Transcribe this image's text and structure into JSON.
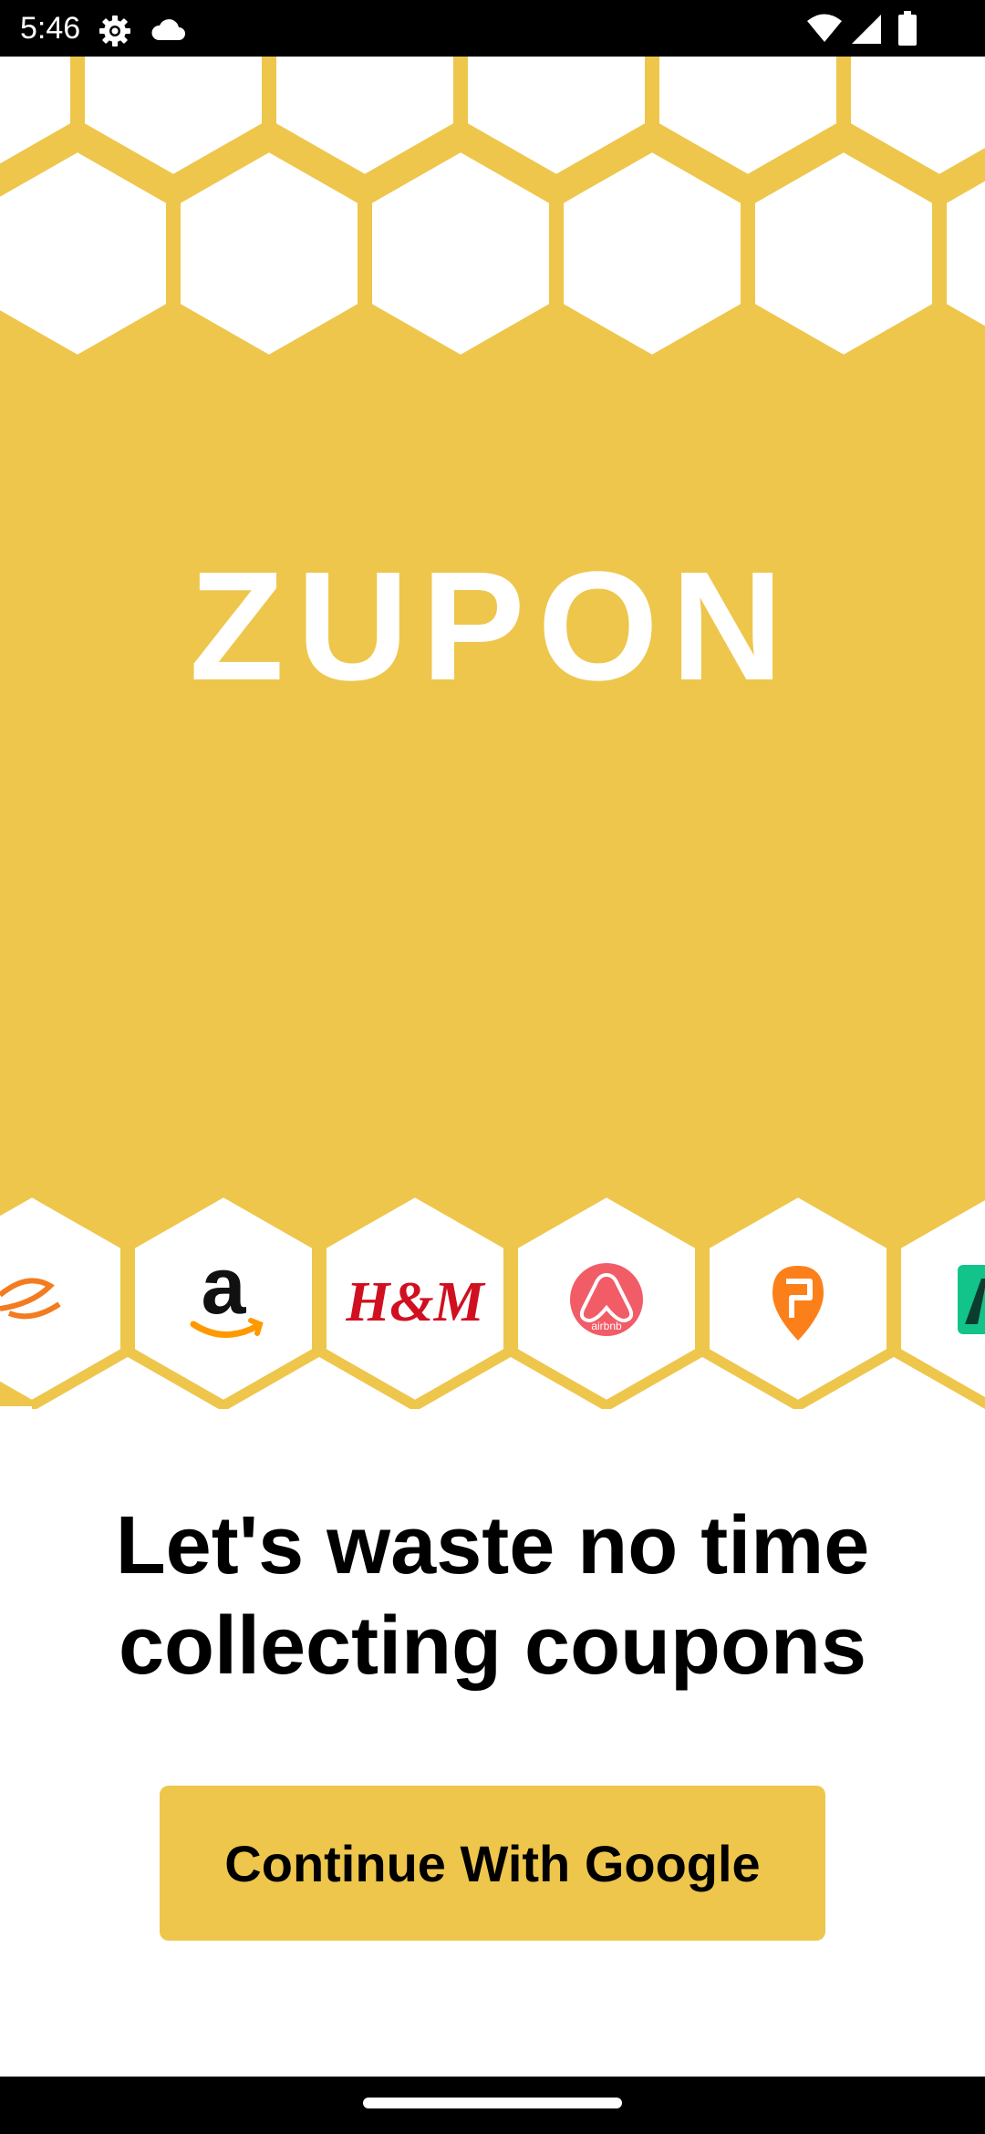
{
  "status_bar": {
    "time": "5:46",
    "icons": [
      "settings-icon",
      "cloud-icon",
      "wifi-icon",
      "signal-icon",
      "battery-icon"
    ]
  },
  "hero": {
    "title": "ZUPON",
    "brand_logos": [
      "alibaba-logo",
      "amazon-logo",
      "hm-logo",
      "airbnb-logo",
      "swiggy-logo",
      "green-brand-logo"
    ],
    "hm_text": "H&M",
    "airbnb_text": "airbnb"
  },
  "main": {
    "tagline_line1": "Let's waste no time",
    "tagline_line2": "collecting coupons",
    "continue_button_label": "Continue With Google"
  },
  "colors": {
    "accent": "#EEC64C",
    "background": "#FFFFFF",
    "text": "#000000",
    "airbnb": "#F15C67",
    "swiggy": "#FC8019",
    "hm": "#D01020"
  }
}
